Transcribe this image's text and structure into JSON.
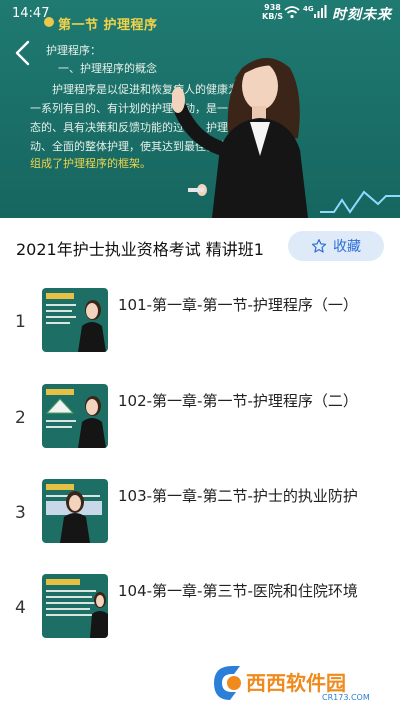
{
  "status_bar": {
    "time": "14:47",
    "net_speed_value": "938",
    "net_speed_unit": "KB/S",
    "network_type": "4G",
    "watermark": "时刻未来"
  },
  "player": {
    "board_title": "第一节 护理程序",
    "lines": [
      "护理程序：",
      "一、护理程序的概念",
      "护理程序是以促进和恢复病人的健康为",
      "一系列有目的、有计划的护理活动，是一个综合",
      "态的、具有决策和反馈功能的过程，护理对象",
      "动、全面的整体护理，使其达到最佳健康状",
      "组成了护理程序的框架。"
    ]
  },
  "course": {
    "title": "2021年护士执业资格考试 精讲班1",
    "favorite_label": "收藏"
  },
  "lessons": [
    {
      "index": "1",
      "title": "101-第一章-第一节-护理程序（一）"
    },
    {
      "index": "2",
      "title": "102-第一章-第一节-护理程序（二）"
    },
    {
      "index": "3",
      "title": "103-第一章-第二节-护士的执业防护"
    },
    {
      "index": "4",
      "title": "104-第一章-第三节-医院和住院环境"
    }
  ],
  "site_watermark": {
    "name": "西西软件园",
    "domain": "CR173.COM"
  },
  "colors": {
    "accent": "#2f6fd6",
    "favorite_bg": "#dfeaf9",
    "board_green": "#1c6e66",
    "board_highlight": "#f0d44c"
  }
}
